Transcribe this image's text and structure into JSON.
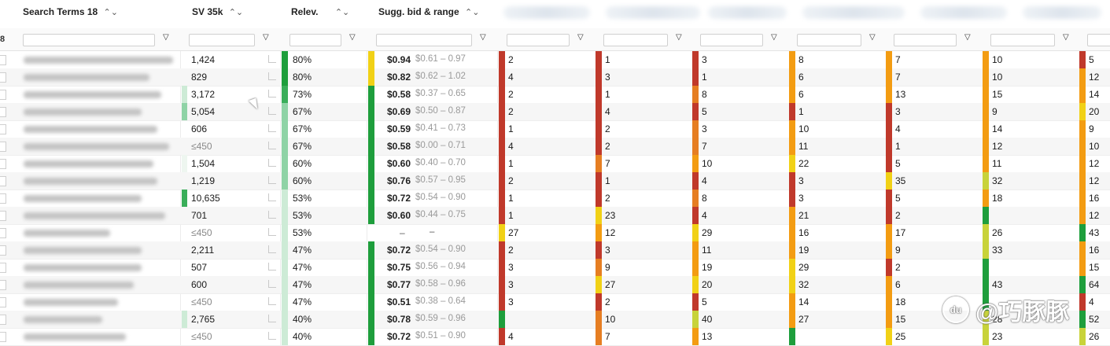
{
  "header": {
    "row_counter": "8",
    "search_terms": "Search Terms",
    "search_terms_count": "18",
    "sv": "SV 35k",
    "relevance": "Relev.",
    "bid": "Sugg. bid & range",
    "sort_glyph": "⌃⌄",
    "filter_glyph": "▽"
  },
  "rank_columns": 9,
  "colors": {
    "red": "#c0392b",
    "orange": "#f39c12",
    "dark_orange": "#e67e22",
    "yellow": "#f1d116",
    "green": "#1e9e3c",
    "light_green": "#8fd3a6",
    "pale_green": "#cdebd6",
    "yellow_green": "#c8d33a"
  },
  "rows": [
    {
      "sv": "1,424",
      "sv_light": false,
      "sv_color": "",
      "rel": "80%",
      "rel_color": "#1e9e3c",
      "bid": "$0.94",
      "range": "$0.61 – 0.97",
      "bid_color": "#f1d116",
      "ranks": [
        [
          "2",
          "#c0392b"
        ],
        [
          "1",
          "#c0392b"
        ],
        [
          "3",
          "#c0392b"
        ],
        [
          "8",
          "#f39c12"
        ],
        [
          "7",
          "#f39c12"
        ],
        [
          "10",
          "#f39c12"
        ],
        [
          "5",
          "#c0392b"
        ]
      ]
    },
    {
      "sv": "829",
      "sv_light": false,
      "sv_color": "",
      "rel": "80%",
      "rel_color": "#1e9e3c",
      "bid": "$0.82",
      "range": "$0.62 – 1.02",
      "bid_color": "#f1d116",
      "ranks": [
        [
          "4",
          "#c0392b"
        ],
        [
          "3",
          "#c0392b"
        ],
        [
          "1",
          "#c0392b"
        ],
        [
          "6",
          "#f39c12"
        ],
        [
          "7",
          "#f39c12"
        ],
        [
          "10",
          "#f39c12"
        ],
        [
          "12",
          "#f39c12"
        ]
      ]
    },
    {
      "sv": "3,172",
      "sv_light": false,
      "sv_color": "#cdebd6",
      "rel": "73%",
      "rel_color": "#3aae5a",
      "bid": "$0.58",
      "range": "$0.37 – 0.65",
      "bid_color": "#1e9e3c",
      "ranks": [
        [
          "2",
          "#c0392b"
        ],
        [
          "1",
          "#c0392b"
        ],
        [
          "8",
          "#e67e22"
        ],
        [
          "6",
          "#f39c12"
        ],
        [
          "13",
          "#f39c12"
        ],
        [
          "15",
          "#f39c12"
        ],
        [
          "14",
          "#f39c12"
        ]
      ]
    },
    {
      "sv": "5,054",
      "sv_light": false,
      "sv_color": "#8fd3a6",
      "rel": "67%",
      "rel_color": "#8fd3a6",
      "bid": "$0.69",
      "range": "$0.50 – 0.87",
      "bid_color": "#1e9e3c",
      "ranks": [
        [
          "2",
          "#c0392b"
        ],
        [
          "4",
          "#c0392b"
        ],
        [
          "5",
          "#c0392b"
        ],
        [
          "1",
          "#c0392b"
        ],
        [
          "3",
          "#c0392b"
        ],
        [
          "9",
          "#f39c12"
        ],
        [
          "20",
          "#f1d116"
        ]
      ]
    },
    {
      "sv": "606",
      "sv_light": false,
      "sv_color": "",
      "rel": "67%",
      "rel_color": "#8fd3a6",
      "bid": "$0.59",
      "range": "$0.41 – 0.73",
      "bid_color": "#1e9e3c",
      "ranks": [
        [
          "1",
          "#c0392b"
        ],
        [
          "2",
          "#c0392b"
        ],
        [
          "3",
          "#e67e22"
        ],
        [
          "10",
          "#f39c12"
        ],
        [
          "4",
          "#c0392b"
        ],
        [
          "14",
          "#f39c12"
        ],
        [
          "9",
          "#f39c12"
        ]
      ]
    },
    {
      "sv": "≤450",
      "sv_light": true,
      "sv_color": "",
      "rel": "67%",
      "rel_color": "#8fd3a6",
      "bid": "$0.58",
      "range": "$0.00 – 0.71",
      "bid_color": "#1e9e3c",
      "ranks": [
        [
          "4",
          "#c0392b"
        ],
        [
          "2",
          "#c0392b"
        ],
        [
          "7",
          "#e67e22"
        ],
        [
          "11",
          "#f39c12"
        ],
        [
          "1",
          "#c0392b"
        ],
        [
          "12",
          "#f39c12"
        ],
        [
          "10",
          "#f39c12"
        ]
      ]
    },
    {
      "sv": "1,504",
      "sv_light": false,
      "sv_color": "#eef6f0",
      "rel": "60%",
      "rel_color": "#8fd3a6",
      "bid": "$0.60",
      "range": "$0.40 – 0.70",
      "bid_color": "#1e9e3c",
      "ranks": [
        [
          "1",
          "#c0392b"
        ],
        [
          "7",
          "#e67e22"
        ],
        [
          "10",
          "#f39c12"
        ],
        [
          "22",
          "#f1d116"
        ],
        [
          "5",
          "#c0392b"
        ],
        [
          "11",
          "#f39c12"
        ],
        [
          "12",
          "#f39c12"
        ]
      ]
    },
    {
      "sv": "1,219",
      "sv_light": false,
      "sv_color": "",
      "rel": "60%",
      "rel_color": "#8fd3a6",
      "bid": "$0.76",
      "range": "$0.57 – 0.95",
      "bid_color": "#1e9e3c",
      "ranks": [
        [
          "2",
          "#c0392b"
        ],
        [
          "1",
          "#c0392b"
        ],
        [
          "4",
          "#c0392b"
        ],
        [
          "3",
          "#c0392b"
        ],
        [
          "35",
          "#f1d116"
        ],
        [
          "32",
          "#c8d33a"
        ],
        [
          "12",
          "#f39c12"
        ]
      ]
    },
    {
      "sv": "10,635",
      "sv_light": false,
      "sv_color": "#3aae5a",
      "rel": "53%",
      "rel_color": "#cdebd6",
      "bid": "$0.72",
      "range": "$0.54 – 0.90",
      "bid_color": "#1e9e3c",
      "ranks": [
        [
          "1",
          "#c0392b"
        ],
        [
          "2",
          "#c0392b"
        ],
        [
          "8",
          "#e67e22"
        ],
        [
          "3",
          "#c0392b"
        ],
        [
          "5",
          "#c0392b"
        ],
        [
          "18",
          "#f39c12"
        ],
        [
          "16",
          "#f39c12"
        ]
      ]
    },
    {
      "sv": "701",
      "sv_light": false,
      "sv_color": "",
      "rel": "53%",
      "rel_color": "#cdebd6",
      "bid": "$0.60",
      "range": "$0.44 – 0.75",
      "bid_color": "#1e9e3c",
      "ranks": [
        [
          "1",
          "#c0392b"
        ],
        [
          "23",
          "#f1d116"
        ],
        [
          "4",
          "#c0392b"
        ],
        [
          "21",
          "#f39c12"
        ],
        [
          "2",
          "#c0392b"
        ],
        [
          "",
          "#1e9e3c"
        ],
        [
          "12",
          "#f39c12"
        ]
      ]
    },
    {
      "sv": "≤450",
      "sv_light": true,
      "sv_color": "",
      "rel": "53%",
      "rel_color": "#cdebd6",
      "bid": "–",
      "range": "–",
      "bid_color": "",
      "ranks": [
        [
          "27",
          "#f1d116"
        ],
        [
          "12",
          "#f39c12"
        ],
        [
          "29",
          "#f1d116"
        ],
        [
          "16",
          "#f39c12"
        ],
        [
          "17",
          "#f39c12"
        ],
        [
          "26",
          "#c8d33a"
        ],
        [
          "43",
          "#1e9e3c"
        ]
      ]
    },
    {
      "sv": "2,211",
      "sv_light": false,
      "sv_color": "",
      "rel": "47%",
      "rel_color": "#cdebd6",
      "bid": "$0.72",
      "range": "$0.54 – 0.90",
      "bid_color": "#1e9e3c",
      "ranks": [
        [
          "2",
          "#c0392b"
        ],
        [
          "3",
          "#c0392b"
        ],
        [
          "11",
          "#f39c12"
        ],
        [
          "19",
          "#f39c12"
        ],
        [
          "9",
          "#f39c12"
        ],
        [
          "33",
          "#c8d33a"
        ],
        [
          "16",
          "#f39c12"
        ]
      ]
    },
    {
      "sv": "507",
      "sv_light": false,
      "sv_color": "",
      "rel": "47%",
      "rel_color": "#cdebd6",
      "bid": "$0.75",
      "range": "$0.56 – 0.94",
      "bid_color": "#1e9e3c",
      "ranks": [
        [
          "3",
          "#c0392b"
        ],
        [
          "9",
          "#e67e22"
        ],
        [
          "19",
          "#f39c12"
        ],
        [
          "29",
          "#f1d116"
        ],
        [
          "2",
          "#c0392b"
        ],
        [
          "",
          "#1e9e3c"
        ],
        [
          "15",
          "#f39c12"
        ]
      ]
    },
    {
      "sv": "600",
      "sv_light": false,
      "sv_color": "",
      "rel": "47%",
      "rel_color": "#cdebd6",
      "bid": "$0.77",
      "range": "$0.58 – 0.96",
      "bid_color": "#1e9e3c",
      "ranks": [
        [
          "3",
          "#c0392b"
        ],
        [
          "27",
          "#f1d116"
        ],
        [
          "20",
          "#f1d116"
        ],
        [
          "32",
          "#f1d116"
        ],
        [
          "6",
          "#f39c12"
        ],
        [
          "43",
          "#1e9e3c"
        ],
        [
          "64",
          "#1e9e3c"
        ]
      ]
    },
    {
      "sv": "≤450",
      "sv_light": true,
      "sv_color": "",
      "rel": "47%",
      "rel_color": "#cdebd6",
      "bid": "$0.51",
      "range": "$0.38 – 0.64",
      "bid_color": "#1e9e3c",
      "ranks": [
        [
          "3",
          "#c0392b"
        ],
        [
          "2",
          "#c0392b"
        ],
        [
          "5",
          "#c0392b"
        ],
        [
          "14",
          "#f39c12"
        ],
        [
          "18",
          "#f39c12"
        ],
        [
          "",
          "#1e9e3c"
        ],
        [
          "4",
          "#c0392b"
        ]
      ]
    },
    {
      "sv": "2,765",
      "sv_light": false,
      "sv_color": "#cdebd6",
      "rel": "40%",
      "rel_color": "#cdebd6",
      "bid": "$0.78",
      "range": "$0.59 – 0.96",
      "bid_color": "#1e9e3c",
      "ranks": [
        [
          "",
          "#1e9e3c"
        ],
        [
          "10",
          "#e67e22"
        ],
        [
          "40",
          "#c8d33a"
        ],
        [
          "27",
          "#f39c12"
        ],
        [
          "15",
          "#f39c12"
        ],
        [
          "28",
          "#c8d33a"
        ],
        [
          "52",
          "#1e9e3c"
        ]
      ]
    },
    {
      "sv": "≤450",
      "sv_light": true,
      "sv_color": "",
      "rel": "40%",
      "rel_color": "#cdebd6",
      "bid": "$0.72",
      "range": "$0.51 – 0.90",
      "bid_color": "#1e9e3c",
      "ranks": [
        [
          "4",
          "#c0392b"
        ],
        [
          "7",
          "#e67e22"
        ],
        [
          "13",
          "#f39c12"
        ],
        [
          "",
          "#1e9e3c"
        ],
        [
          "25",
          "#f1d116"
        ],
        [
          "23",
          "#c8d33a"
        ],
        [
          "26",
          "#c8d33a"
        ]
      ]
    }
  ],
  "watermark": {
    "logo": "du",
    "text": "@巧豚豚"
  }
}
